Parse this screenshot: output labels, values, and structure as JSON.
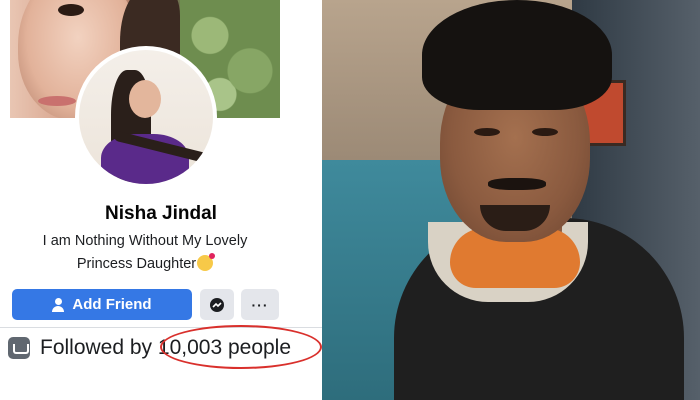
{
  "profile": {
    "name": "Nisha Jindal",
    "bio_line1": "I am Nothing Without My Lovely",
    "bio_line2": "Princess Daughter"
  },
  "actions": {
    "add_friend_label": "Add Friend",
    "more_label": "···"
  },
  "followers": {
    "text": "Followed by 10,003 people"
  },
  "colors": {
    "primary_button": "#3578e5",
    "annotation_circle": "#d9302c"
  },
  "icons": [
    "person-add-icon",
    "messenger-icon",
    "more-icon",
    "followers-icon",
    "kiss-emoji-icon"
  ]
}
